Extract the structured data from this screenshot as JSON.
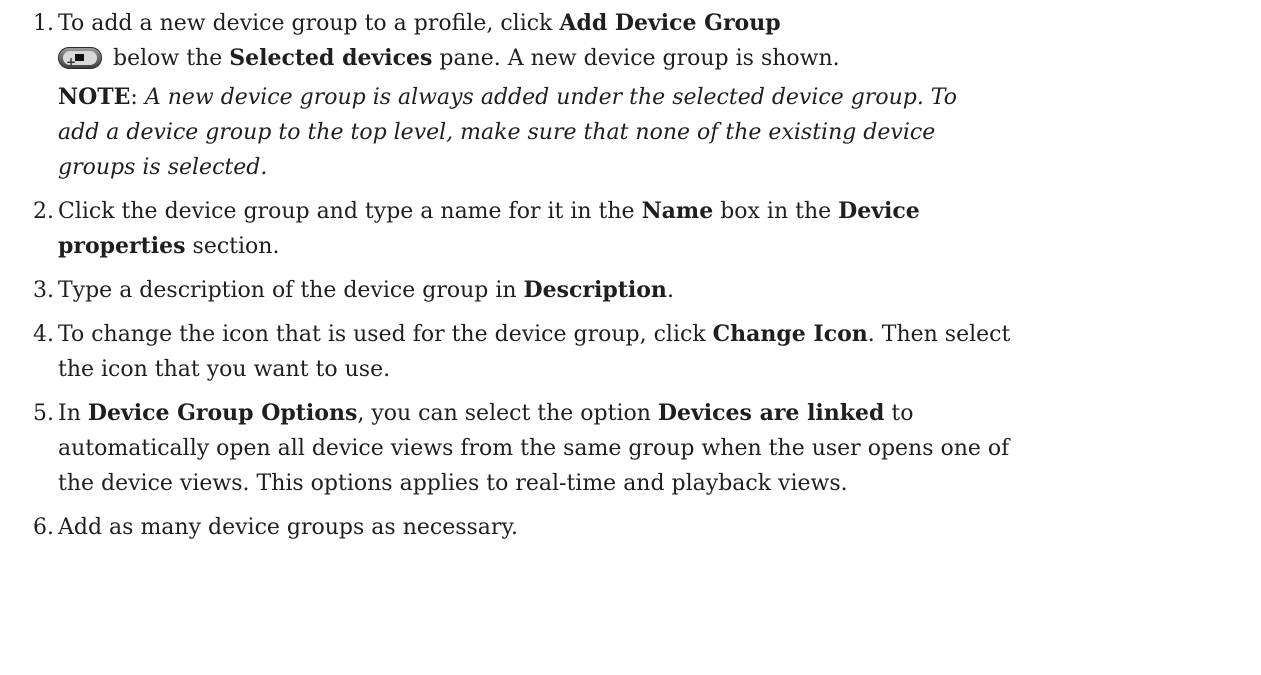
{
  "steps": [
    {
      "number": "1.",
      "line1_pre": "To add a new device group to a profile, click ",
      "line1_bold": "Add Device Group",
      "line2_pre": " below the ",
      "line2_bold": "Selected devices",
      "line2_post": " pane. A new device group is shown.",
      "note_label": "NOTE",
      "note_colon": ": ",
      "note_text1": "A new device group is always added under the selected device group. To",
      "note_text2": "add a device group to the top level, make sure that none of the existing device",
      "note_text3": "groups is selected.",
      "icon": "add-device-group-icon"
    },
    {
      "number": "2.",
      "pre": "Click the device group and type a name for it in the ",
      "bold1": "Name",
      "mid": " box in the ",
      "bold2a": "Device",
      "bold2b": "properties",
      "post": " section."
    },
    {
      "number": "3.",
      "pre": "Type a description of the device group in ",
      "bold": "Description",
      "post": "."
    },
    {
      "number": "4.",
      "pre": "To change the icon that is used for the device group, click ",
      "bold": "Change Icon",
      "post1": ". Then select",
      "post2": "the icon that you want to use."
    },
    {
      "number": "5.",
      "pre": "In ",
      "bold1": "Device Group Options",
      "mid": ", you can select the option ",
      "bold2": "Devices are linked",
      "post1": " to",
      "line2": "automatically open all device views from the same group when the user opens one of",
      "line3": "the device views. This options applies to real-time and playback views."
    },
    {
      "number": "6.",
      "text": "Add as many device groups as necessary."
    }
  ]
}
